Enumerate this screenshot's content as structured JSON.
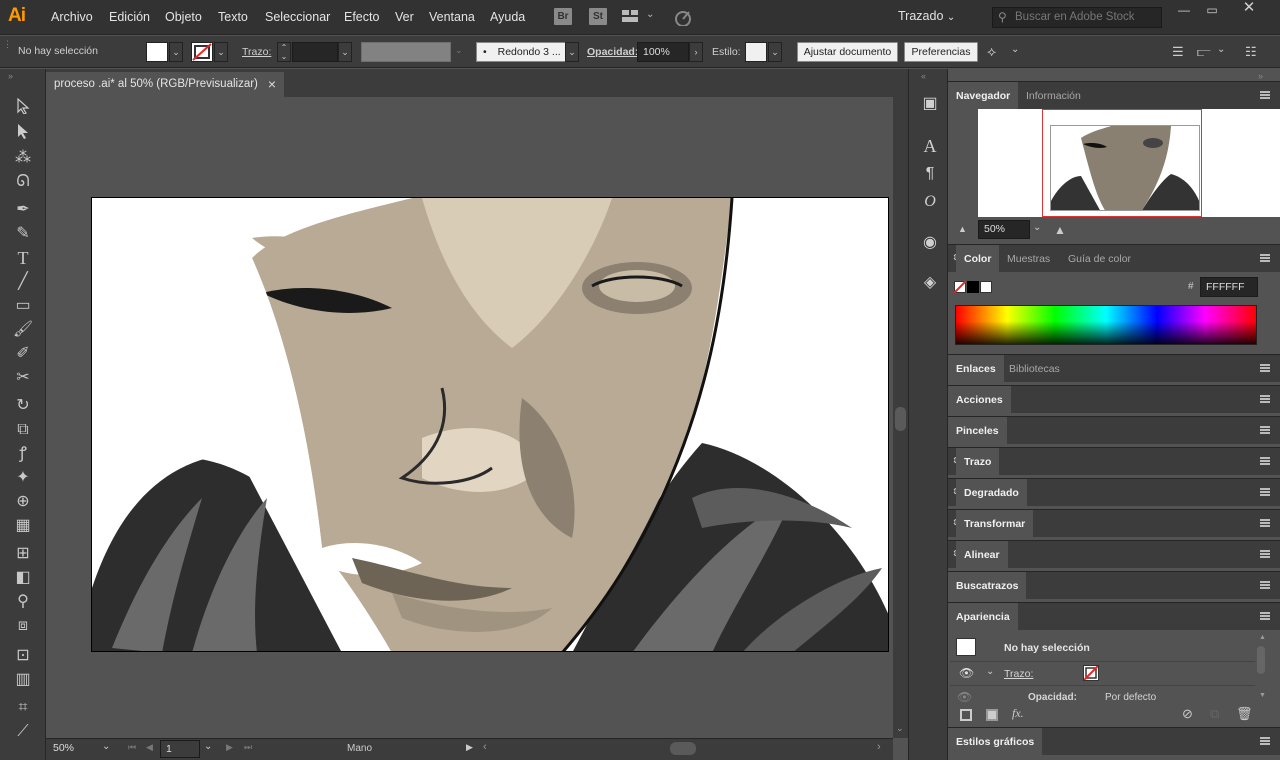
{
  "app": {
    "logo": "Ai"
  },
  "menu": [
    "Archivo",
    "Edición",
    "Objeto",
    "Texto",
    "Seleccionar",
    "Efecto",
    "Ver",
    "Ventana",
    "Ayuda"
  ],
  "menubar_buttons": {
    "bridge": "Br",
    "stock": "St"
  },
  "workspace": "Trazado",
  "stock_search": {
    "placeholder": "Buscar en Adobe Stock"
  },
  "control": {
    "selection": "No hay selección",
    "stroke_label": "Trazo:",
    "brush": "Redondo 3 ...",
    "opacity_label": "Opacidad:",
    "opacity_value": "100%",
    "style_label": "Estilo:",
    "adjust_button": "Ajustar documento",
    "prefs_button": "Preferencias"
  },
  "document_tab": {
    "title": "proceso .ai* al 50% (RGB/Previsualizar)",
    "close": "×"
  },
  "status": {
    "zoom": "50%",
    "page": "1",
    "tool": "Mano"
  },
  "navigator": {
    "tabs": [
      "Navegador",
      "Información"
    ],
    "zoom": "50%"
  },
  "color": {
    "tabs": [
      "Color",
      "Muestras",
      "Guía de color"
    ],
    "hex_label": "#",
    "hex": "FFFFFF"
  },
  "links": {
    "tabs": [
      "Enlaces",
      "Bibliotecas"
    ]
  },
  "panels": [
    "Acciones",
    "Pinceles",
    "Trazo",
    "Degradado",
    "Transformar",
    "Alinear",
    "Buscatrazos"
  ],
  "appearance": {
    "title": "Apariencia",
    "no_selection": "No hay selección",
    "stroke": "Trazo:",
    "opacity_label": "Opacidad:",
    "opacity_value": "Por defecto",
    "fx": "fx."
  },
  "graphic_styles": "Estilos gráficos"
}
